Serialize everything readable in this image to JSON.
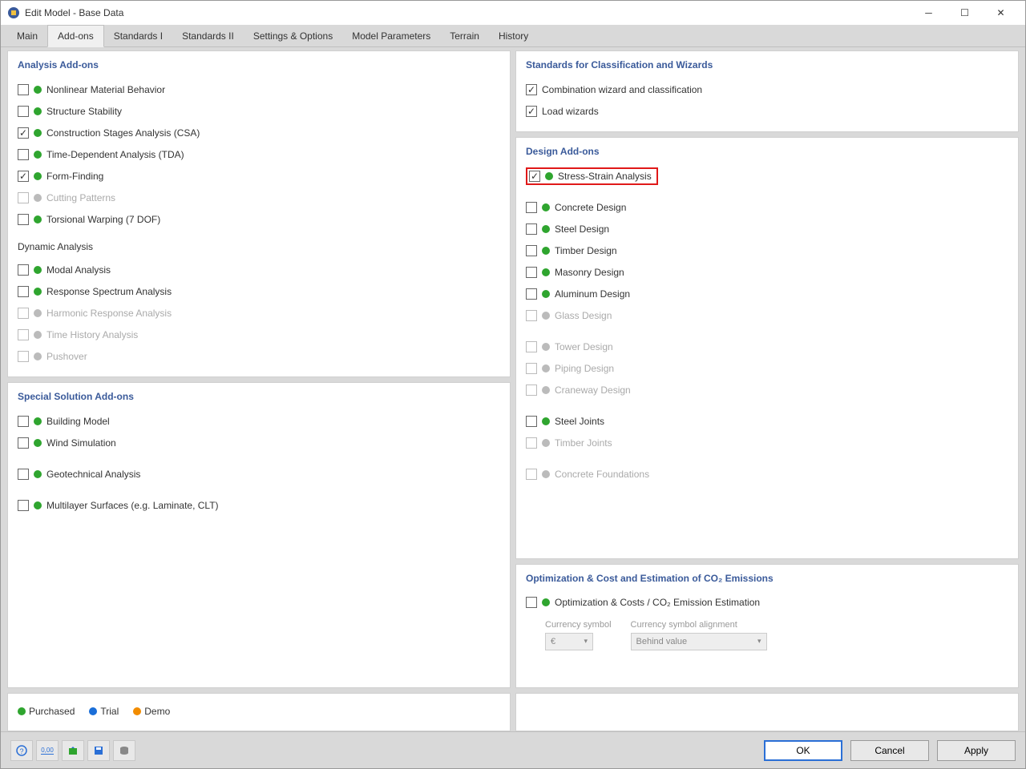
{
  "window": {
    "title": "Edit Model - Base Data"
  },
  "tabs": [
    "Main",
    "Add-ons",
    "Standards I",
    "Standards II",
    "Settings & Options",
    "Model Parameters",
    "Terrain",
    "History"
  ],
  "active_tab": 1,
  "sections": {
    "analysis": {
      "title": "Analysis Add-ons",
      "items": [
        {
          "label": "Nonlinear Material Behavior",
          "checked": false,
          "status": "green",
          "disabled": false
        },
        {
          "label": "Structure Stability",
          "checked": false,
          "status": "green",
          "disabled": false
        },
        {
          "label": "Construction Stages Analysis (CSA)",
          "checked": true,
          "status": "green",
          "disabled": false
        },
        {
          "label": "Time-Dependent Analysis (TDA)",
          "checked": false,
          "status": "green",
          "disabled": false
        },
        {
          "label": "Form-Finding",
          "checked": true,
          "status": "green",
          "disabled": false
        },
        {
          "label": "Cutting Patterns",
          "checked": false,
          "status": "grey",
          "disabled": true
        },
        {
          "label": "Torsional Warping (7 DOF)",
          "checked": false,
          "status": "green",
          "disabled": false
        }
      ],
      "dynamic_title": "Dynamic Analysis",
      "dynamic": [
        {
          "label": "Modal Analysis",
          "checked": false,
          "status": "green",
          "disabled": false
        },
        {
          "label": "Response Spectrum Analysis",
          "checked": false,
          "status": "green",
          "disabled": false
        },
        {
          "label": "Harmonic Response Analysis",
          "checked": false,
          "status": "grey",
          "disabled": true
        },
        {
          "label": "Time History Analysis",
          "checked": false,
          "status": "grey",
          "disabled": true
        },
        {
          "label": "Pushover",
          "checked": false,
          "status": "grey",
          "disabled": true
        }
      ]
    },
    "special": {
      "title": "Special Solution Add-ons",
      "groups": [
        [
          {
            "label": "Building Model",
            "checked": false,
            "status": "green",
            "disabled": false
          },
          {
            "label": "Wind Simulation",
            "checked": false,
            "status": "green",
            "disabled": false
          }
        ],
        [
          {
            "label": "Geotechnical Analysis",
            "checked": false,
            "status": "green",
            "disabled": false
          }
        ],
        [
          {
            "label": "Multilayer Surfaces (e.g. Laminate, CLT)",
            "checked": false,
            "status": "green",
            "disabled": false
          }
        ]
      ]
    },
    "standards": {
      "title": "Standards for Classification and Wizards",
      "items": [
        {
          "label": "Combination wizard and classification",
          "checked": true
        },
        {
          "label": "Load wizards",
          "checked": true
        }
      ]
    },
    "design": {
      "title": "Design Add-ons",
      "highlighted": {
        "label": "Stress-Strain Analysis",
        "checked": true,
        "status": "green",
        "disabled": false
      },
      "groups": [
        [
          {
            "label": "Concrete Design",
            "checked": false,
            "status": "green",
            "disabled": false
          },
          {
            "label": "Steel Design",
            "checked": false,
            "status": "green",
            "disabled": false
          },
          {
            "label": "Timber Design",
            "checked": false,
            "status": "green",
            "disabled": false
          },
          {
            "label": "Masonry Design",
            "checked": false,
            "status": "green",
            "disabled": false
          },
          {
            "label": "Aluminum Design",
            "checked": false,
            "status": "green",
            "disabled": false
          },
          {
            "label": "Glass Design",
            "checked": false,
            "status": "grey",
            "disabled": true
          }
        ],
        [
          {
            "label": "Tower Design",
            "checked": false,
            "status": "grey",
            "disabled": true
          },
          {
            "label": "Piping Design",
            "checked": false,
            "status": "grey",
            "disabled": true
          },
          {
            "label": "Craneway Design",
            "checked": false,
            "status": "grey",
            "disabled": true
          }
        ],
        [
          {
            "label": "Steel Joints",
            "checked": false,
            "status": "green",
            "disabled": false
          },
          {
            "label": "Timber Joints",
            "checked": false,
            "status": "grey",
            "disabled": true
          }
        ],
        [
          {
            "label": "Concrete Foundations",
            "checked": false,
            "status": "grey",
            "disabled": true
          }
        ]
      ]
    },
    "optimization": {
      "title": "Optimization & Cost and Estimation of CO₂ Emissions",
      "item": {
        "label": "Optimization & Costs / CO₂ Emission Estimation",
        "checked": false,
        "status": "green",
        "disabled": false
      },
      "currency_label": "Currency symbol",
      "currency_value": "€",
      "align_label": "Currency symbol alignment",
      "align_value": "Behind value"
    }
  },
  "legend": {
    "purchased": "Purchased",
    "trial": "Trial",
    "demo": "Demo"
  },
  "buttons": {
    "ok": "OK",
    "cancel": "Cancel",
    "apply": "Apply"
  }
}
